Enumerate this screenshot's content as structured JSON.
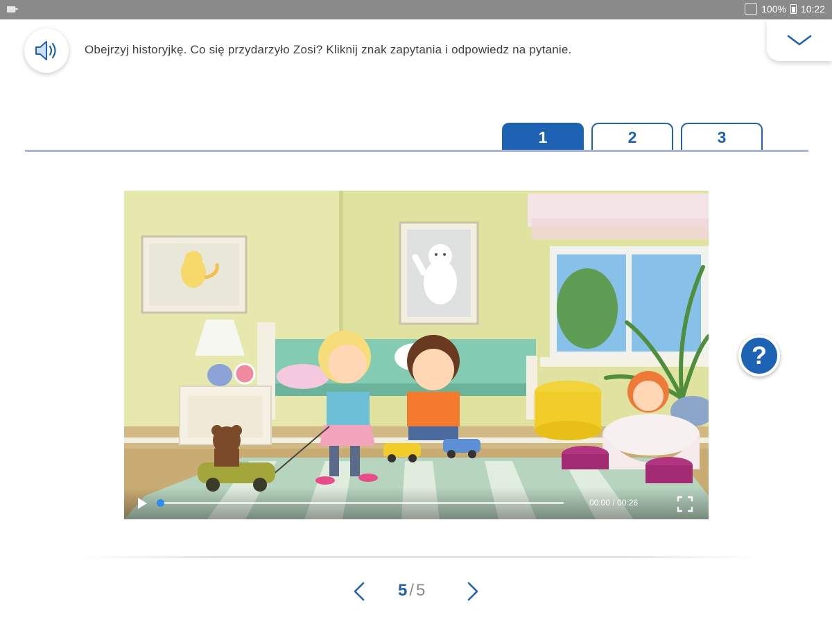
{
  "status_bar": {
    "battery": "100%",
    "time": "10:22",
    "icons": [
      "camera-icon",
      "nfc-icon",
      "battery-icon"
    ]
  },
  "header": {
    "speaker_icon": "speaker-icon",
    "instruction": "Obejrzyj historyjkę. Co się przydarzyło Zosi? Kliknij znak zapytania i odpowiedz na pytanie.",
    "collapse_icon": "chevron-down-icon"
  },
  "tabs": [
    {
      "label": "1",
      "active": true
    },
    {
      "label": "2",
      "active": false
    },
    {
      "label": "3",
      "active": false
    }
  ],
  "video": {
    "current_time": "00:00",
    "duration": "00:26",
    "time_display": "00:00 / 00:26",
    "progress_fraction": 0.0,
    "play_icon": "play-icon",
    "fullscreen_icon": "fullscreen-icon"
  },
  "question_button": {
    "label": "?"
  },
  "pager": {
    "current": "5",
    "separator": "/",
    "total": "5",
    "prev_icon": "chevron-left-icon",
    "next_icon": "chevron-right-icon"
  },
  "colors": {
    "primary_blue": "#1e62b4",
    "tab_line": "#a8b5dc",
    "progress": "#2e8de8",
    "status_bar": "#8a8a8a"
  }
}
